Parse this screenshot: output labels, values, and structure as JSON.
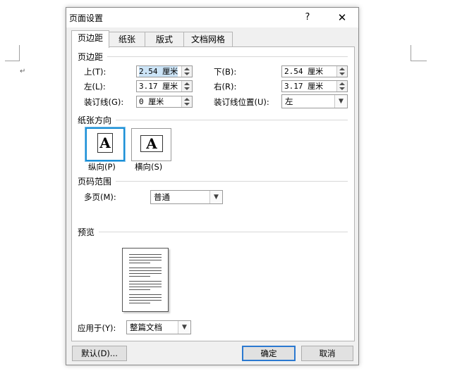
{
  "background": {
    "paragraph_mark": "↵"
  },
  "dialog": {
    "title": "页面设置",
    "help_label": "?",
    "close_label": "✕",
    "tabs": [
      "页边距",
      "纸张",
      "版式",
      "文档网格"
    ],
    "margins": {
      "section_label": "页边距",
      "top_label": "上(T):",
      "top_value": "2.54 厘米",
      "bottom_label": "下(B):",
      "bottom_value": "2.54 厘米",
      "left_label": "左(L):",
      "left_value": "3.17 厘米",
      "right_label": "右(R):",
      "right_value": "3.17 厘米",
      "gutter_label": "装订线(G):",
      "gutter_value": "0 厘米",
      "gutter_pos_label": "装订线位置(U):",
      "gutter_pos_value": "左"
    },
    "orientation": {
      "section_label": "纸张方向",
      "portrait_label": "纵向(P)",
      "landscape_label": "横向(S)",
      "icon_letter": "A"
    },
    "pages": {
      "section_label": "页码范围",
      "multiple_label": "多页(M):",
      "multiple_value": "普通"
    },
    "preview": {
      "section_label": "预览"
    },
    "apply_label": "应用于(Y):",
    "apply_value": "整篇文档",
    "buttons": {
      "default": "默认(D)...",
      "ok": "确定",
      "cancel": "取消"
    }
  },
  "colors": {
    "accent": "#1a8fd6",
    "selection": "#cce4f7",
    "dialog_bg": "#f0f0f0"
  }
}
